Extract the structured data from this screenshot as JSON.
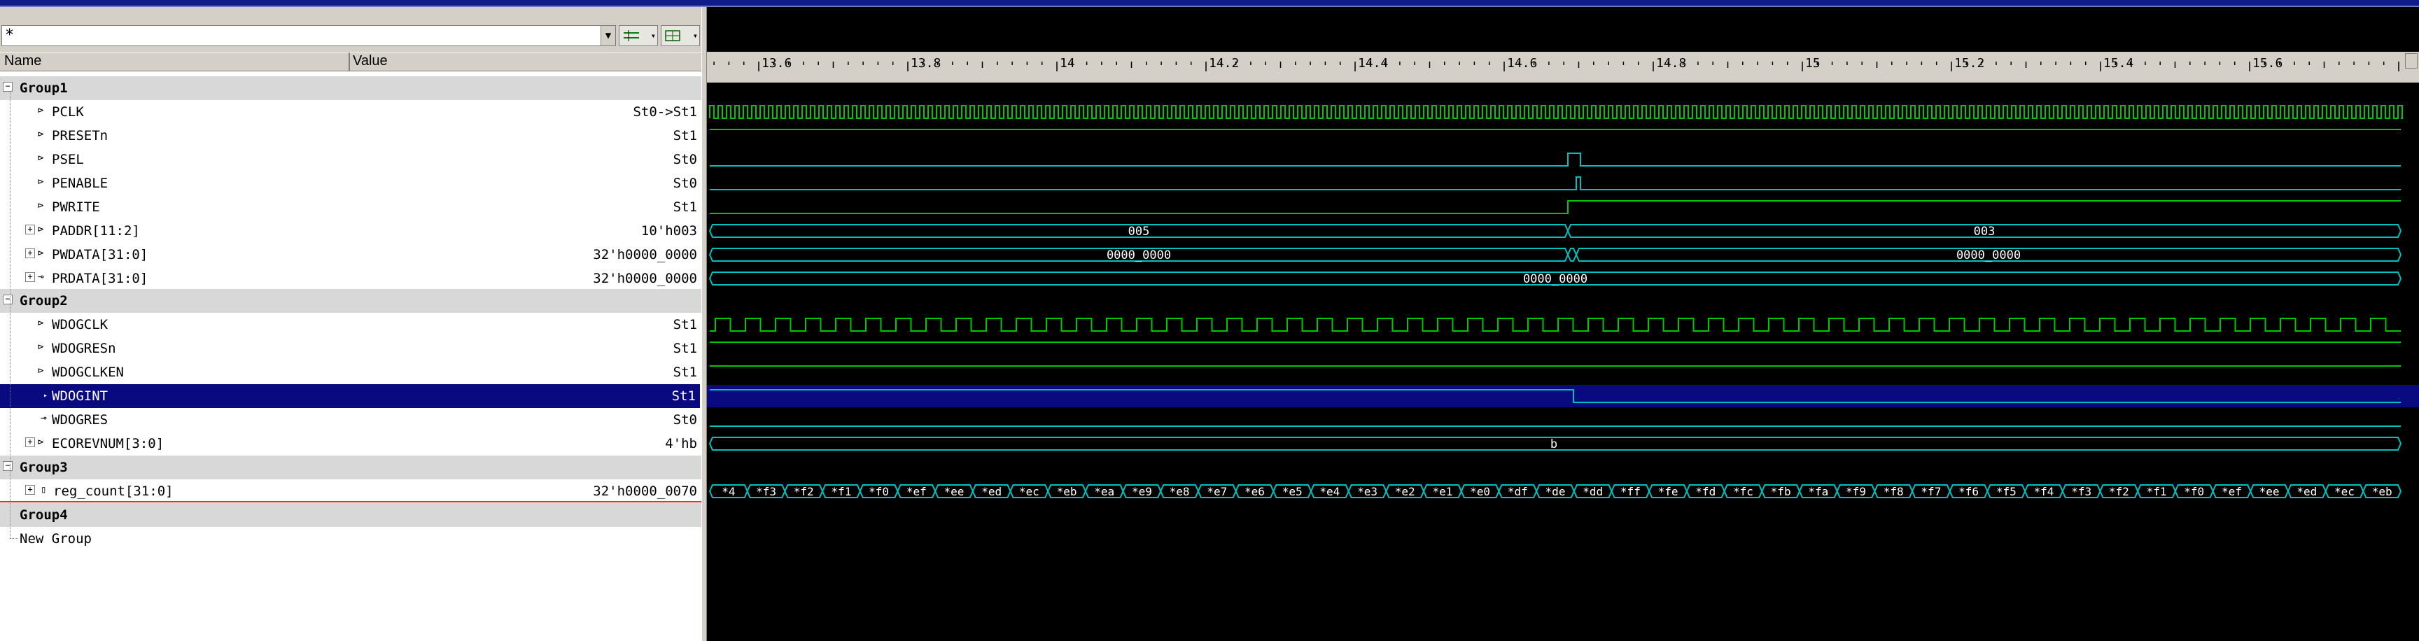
{
  "window": {
    "title_strip_color": "#101c8a"
  },
  "filter": {
    "value": "*"
  },
  "toolbar": {
    "combo_icon": "chevron-down-icon",
    "btn1_icon": "signal-list-icon",
    "btn2_icon": "grid-icon"
  },
  "columns": {
    "name": "Name",
    "value": "Value"
  },
  "groups": [
    {
      "label": "Group1"
    },
    {
      "label": "Group2"
    },
    {
      "label": "Group3"
    },
    {
      "label": "Group4"
    }
  ],
  "signals": {
    "pclk": {
      "name": "PCLK",
      "value": "St0->St1"
    },
    "presetn": {
      "name": "PRESETn",
      "value": "St1"
    },
    "psel": {
      "name": "PSEL",
      "value": "St0"
    },
    "penable": {
      "name": "PENABLE",
      "value": "St0"
    },
    "pwrite": {
      "name": "PWRITE",
      "value": "St1"
    },
    "paddr": {
      "name": "PADDR[11:2]",
      "value": "10'h003"
    },
    "pwdata": {
      "name": "PWDATA[31:0]",
      "value": "32'h0000_0000"
    },
    "prdata": {
      "name": "PRDATA[31:0]",
      "value": "32'h0000_0000"
    },
    "wdogclk": {
      "name": "WDOGCLK",
      "value": "St1"
    },
    "wdogresn": {
      "name": "WDOGRESn",
      "value": "St1"
    },
    "wdogclken": {
      "name": "WDOGCLKEN",
      "value": "St1"
    },
    "wdogint": {
      "name": "WDOGINT",
      "value": "St1"
    },
    "wdogres": {
      "name": "WDOGRES",
      "value": "St0"
    },
    "ecorevnum": {
      "name": "ECOREVNUM[3:0]",
      "value": "4'hb"
    },
    "reg_count": {
      "name": "reg_count[31:0]",
      "value": "32'h0000_0070"
    }
  },
  "new_group": "New Group",
  "ruler": {
    "labels": [
      "13.6",
      "13.8",
      "14",
      "14.2",
      "14.4",
      "14.6",
      "14.8",
      "15",
      "15.2",
      "15.4",
      "15.6"
    ]
  },
  "bus_values": {
    "paddr_before": "005",
    "paddr_after": "003",
    "pwdata_before": "0000_0000",
    "pwdata_after": "0000_0000",
    "prdata": "0000_0000",
    "ecorevnum": "b"
  },
  "reg_count_values": [
    "*4",
    "*f3",
    "*f2",
    "*f1",
    "*f0",
    "*ef",
    "*ee",
    "*ed",
    "*ec",
    "*eb",
    "*ea",
    "*e9",
    "*e8",
    "*e7",
    "*e6",
    "*e5",
    "*e4",
    "*e3",
    "*e2",
    "*e1",
    "*e0",
    "*df",
    "*de",
    "*dd",
    "*ff",
    "*fe",
    "*fd",
    "*fc",
    "*fb",
    "*fa",
    "*f9",
    "*f8",
    "*f7",
    "*f6",
    "*f5",
    "*f4",
    "*f3",
    "*f2",
    "*f1",
    "*f0",
    "*ef",
    "*ee",
    "*ed",
    "*ec",
    "*eb"
  ],
  "colors": {
    "wave_green": "#00c800",
    "wave_cyan": "#00c0c0",
    "selection": "#0a0a80",
    "background": "#000000"
  }
}
